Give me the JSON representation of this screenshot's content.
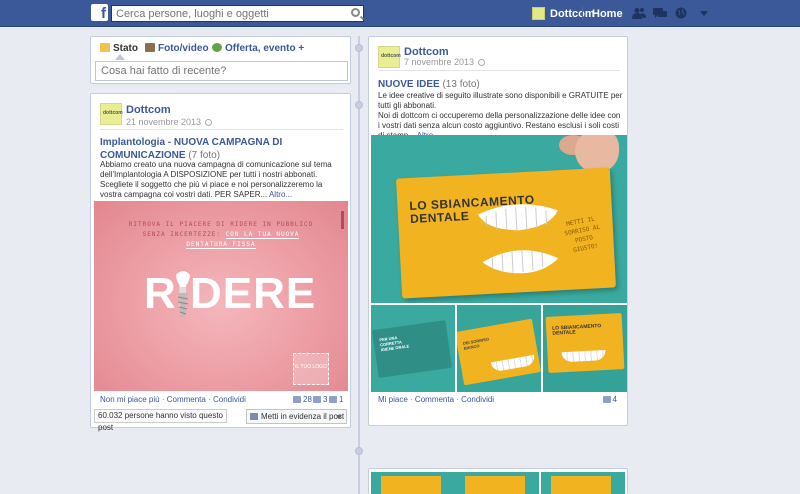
{
  "topbar": {
    "search_placeholder": "Cerca persone, luoghi e oggetti",
    "page_name": "Dottcom",
    "home_label": "Home",
    "brand_color": "#3b5998"
  },
  "composer": {
    "tabs": [
      {
        "label": "Stato",
        "icon": "status-icon"
      },
      {
        "label": "Foto/video",
        "icon": "photo-icon"
      },
      {
        "label": "Offerta, evento +",
        "icon": "offer-icon"
      }
    ],
    "placeholder": "Cosa hai fatto di recente?"
  },
  "post_left": {
    "author": "Dottcom",
    "date": "21 novembre 2013",
    "title": "Implantologia - NUOVA CAMPAGNA DI COMUNICAZIONE",
    "title_count": "(7 foto)",
    "body": "Abbiamo creato una nuova campagna di comunicazione sul tema dell'Implantologia A DISPOSIZIONE per tutti i nostri abbonati. Scegliete il soggetto che più vi piace e noi personalizzeremo la vostra campagna coi vostri dati. PER SAPER...",
    "more": "Altro...",
    "image": {
      "line1": "RITROVA IL PIACERE DI RIDERE IN PUBBLICO",
      "line2a": "SENZA INCERTEZZE: ",
      "line2b": "CON LA TUA NUOVA",
      "line3": "DENTATURA FISSA",
      "word": "RIDERE",
      "logo_box": "IL TUO LOGO"
    },
    "actions": {
      "unlike": "Non mi piace più",
      "comment": "Commenta",
      "share": "Condividi"
    },
    "likes": "28",
    "comments": "3",
    "shares": "1",
    "views": "60.032 persone hanno visto questo post",
    "highlight": "Metti in evidenza il post"
  },
  "post_right": {
    "author": "Dottcom",
    "date": "7 novembre 2013",
    "title": "NUOVE IDEE",
    "title_count": "(13 foto)",
    "body1": "Le idee creative di seguito illustrate sono disponibili e GRATUITE per tutti gli abbonati.",
    "body2": "Noi di dottcom ci occuperemo della personalizzazione delle idee con i vostri dati senza alcun costo aggiuntivo. Restano esclusi i soli costi di stamp...",
    "more": "Altro",
    "image": {
      "title1": "LO SBIANCAMENTO",
      "title2": "DENTALE",
      "side": "METTI IL SORRISO AL POSTO GIUSTO!"
    },
    "thumbs": [
      {
        "text": "PER UNA CORRETTA IGIENE ORALE"
      },
      {
        "text": "DEI SORRISO BIANCO"
      },
      {
        "text": "LO SBIANCAMENTO DENTALE"
      }
    ],
    "actions": {
      "like": "Mi piace",
      "comment": "Commenta",
      "share": "Condividi"
    },
    "likes": "4"
  }
}
